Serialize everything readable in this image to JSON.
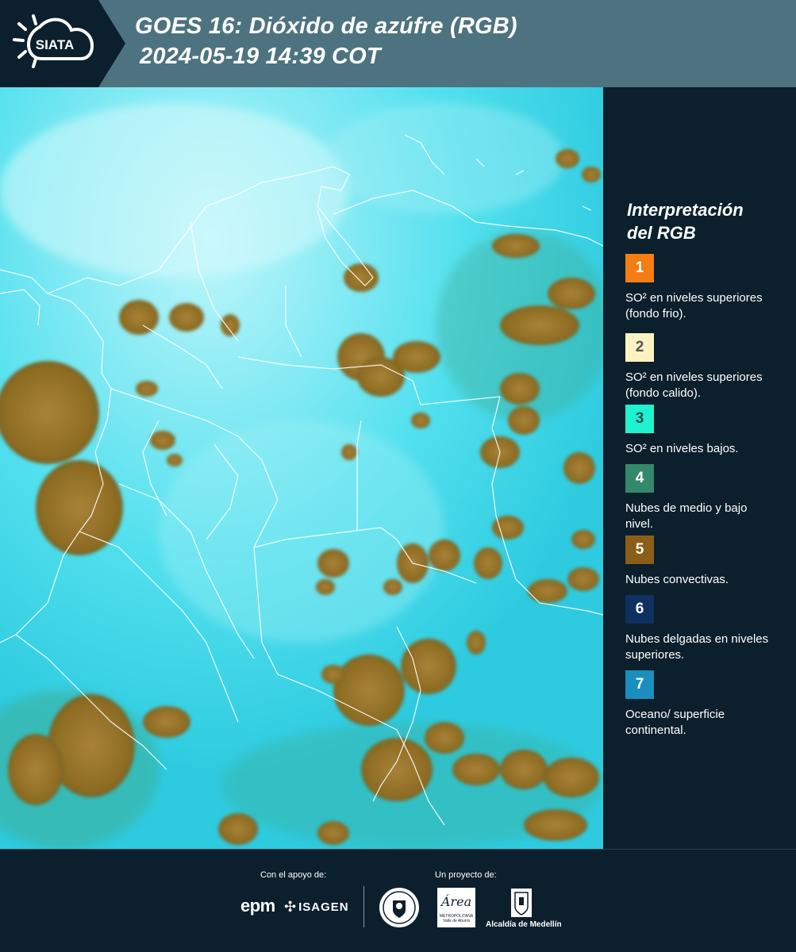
{
  "header": {
    "logo_text": "SIATA",
    "title_line1": "GOES 16: Dióxido de azúfre (RGB)",
    "title_line2": "2024-05-19 14:39 COT"
  },
  "legend": {
    "title_line1": "Interpretación",
    "title_line2": "del RGB",
    "items": [
      {
        "num": "1",
        "color": "#f47d14",
        "num_color": "#ffffff",
        "text": "SO² en niveles superiores (fondo frio)."
      },
      {
        "num": "2",
        "color": "#fcf3c0",
        "num_color": "#555555",
        "text": "SO² en niveles superiores (fondo calido)."
      },
      {
        "num": "3",
        "color": "#1ef2d0",
        "num_color": "#0c4a44",
        "text": "SO² en niveles bajos."
      },
      {
        "num": "4",
        "color": "#33896a",
        "num_color": "#ffffff",
        "text": "Nubes de medio y bajo nivel."
      },
      {
        "num": "5",
        "color": "#8b5e18",
        "num_color": "#ffffff",
        "text": "Nubes convectivas."
      },
      {
        "num": "6",
        "color": "#0f3160",
        "num_color": "#ffffff",
        "text": "Nubes delgadas en niveles superiores."
      },
      {
        "num": "7",
        "color": "#1a8fbf",
        "num_color": "#ffffff",
        "text": "Oceano/ superficie continental."
      }
    ]
  },
  "footer": {
    "support_label": "Con el apoyo de:",
    "project_label": "Un proyecto de:",
    "epm_text": "epm",
    "isagen_text": "ISAGEN",
    "area_text": "Área",
    "area_sub": "METROPOLITANA",
    "area_sub2": "Valle de Aburrá",
    "alcaldia_text": "Alcaldía de Medellín"
  },
  "colors": {
    "background": "#0c1f2c",
    "header_band": "#4d7380",
    "ocean": "#30cfe3",
    "cloud": "#9c7a2a",
    "border_line": "#ffffff"
  }
}
